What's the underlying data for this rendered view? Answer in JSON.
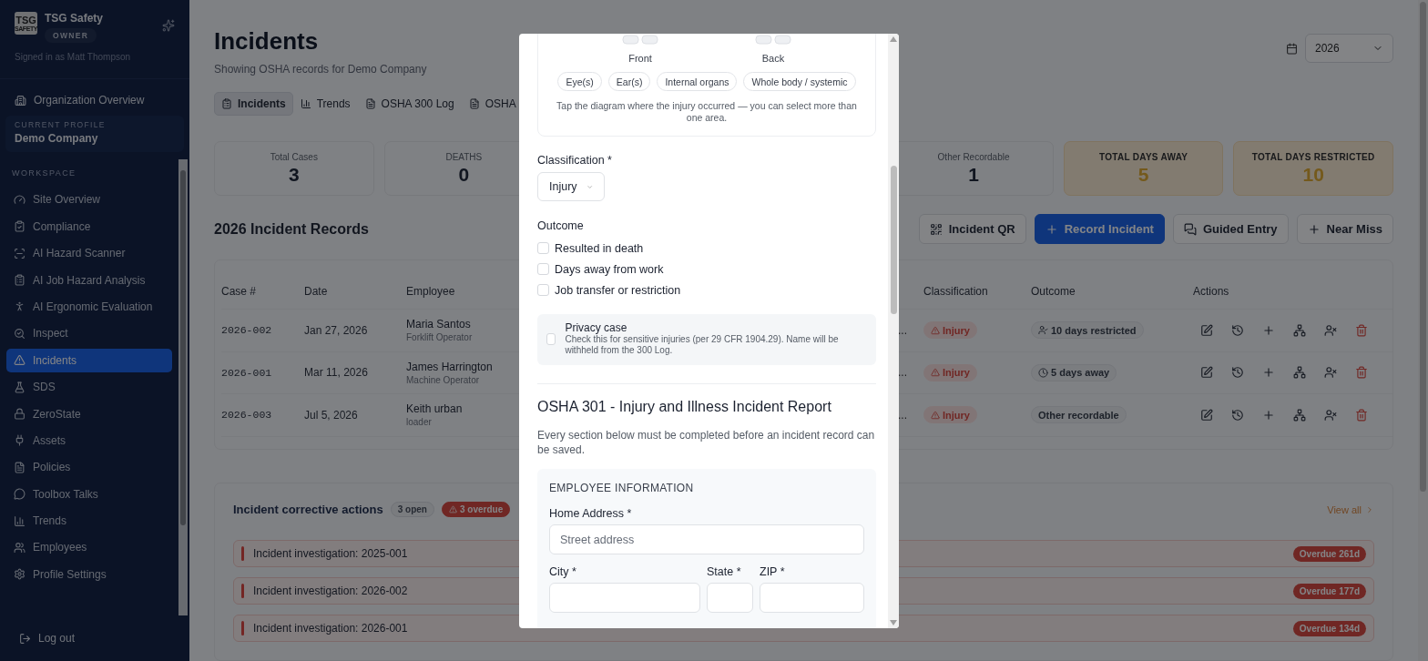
{
  "sidebar": {
    "brand": {
      "logo_top": "TSG",
      "logo_bottom": "SAFETY",
      "name": "TSG Safety",
      "role": "OWNER"
    },
    "signed_in": "Signed in as Matt Thompson",
    "org_link": "Organization Overview",
    "profile": {
      "label": "CURRENT PROFILE",
      "name": "Demo Company"
    },
    "section": "WORKSPACE",
    "items": [
      {
        "label": "Site Overview",
        "selected": false
      },
      {
        "label": "Compliance",
        "selected": false
      },
      {
        "label": "AI Hazard Scanner",
        "selected": false
      },
      {
        "label": "AI Job Hazard Analysis",
        "selected": false
      },
      {
        "label": "AI Ergonomic Evaluation",
        "selected": false
      },
      {
        "label": "Inspect",
        "selected": false
      },
      {
        "label": "Incidents",
        "selected": true
      },
      {
        "label": "SDS",
        "selected": false
      },
      {
        "label": "ZeroState",
        "selected": false
      },
      {
        "label": "Assets",
        "selected": false
      },
      {
        "label": "Policies",
        "selected": false
      },
      {
        "label": "Toolbox Talks",
        "selected": false
      },
      {
        "label": "Trends",
        "selected": false
      },
      {
        "label": "Employees",
        "selected": false
      },
      {
        "label": "Profile Settings",
        "selected": false
      }
    ],
    "logout": "Log out"
  },
  "header": {
    "title": "Incidents",
    "subtitle": "Showing OSHA records for Demo Company",
    "year": "2026"
  },
  "tabs": [
    {
      "label": "Incidents",
      "selected": true
    },
    {
      "label": "Trends",
      "selected": false
    },
    {
      "label": "OSHA 300 Log",
      "selected": false
    },
    {
      "label": "OSHA",
      "selected": false
    }
  ],
  "stats": [
    {
      "label": "Total Cases",
      "value": "3",
      "highlight": false
    },
    {
      "label": "DEATHS",
      "value": "0",
      "highlight": false
    },
    {
      "label": "Other Recordable",
      "value": "1",
      "highlight": false
    },
    {
      "label": "TOTAL DAYS AWAY",
      "value": "5",
      "highlight": true
    },
    {
      "label": "TOTAL DAYS RESTRICTED",
      "value": "10",
      "highlight": true
    }
  ],
  "records": {
    "title": "2026 Incident Records",
    "buttons": [
      {
        "label": "Incident QR",
        "kind": "qr",
        "primary": false
      },
      {
        "label": "Record Incident",
        "kind": "plus",
        "primary": true
      },
      {
        "label": "Guided Entry",
        "kind": "chat",
        "primary": false
      },
      {
        "label": "Near Miss",
        "kind": "plus",
        "primary": false
      }
    ]
  },
  "table": {
    "columns": [
      "Case #",
      "Date",
      "Employee",
      "Classification",
      "Outcome",
      "Actions"
    ],
    "rows": [
      {
        "case": "2026-002",
        "date": "Jan 27, 2026",
        "employee": "Maria Santos",
        "role": "Forklift Operator",
        "column_4": "...",
        "classification": "Injury",
        "outcome": "10 days restricted",
        "kind": "restricted"
      },
      {
        "case": "2026-001",
        "date": "Mar 11, 2026",
        "employee": "James Harrington",
        "role": "Machine Operator",
        "column_4": "...",
        "classification": "Injury",
        "outcome": "5 days away",
        "kind": "away"
      },
      {
        "case": "2026-003",
        "date": "Jul 5, 2026",
        "employee": "Keith urban",
        "role": "loader",
        "column_4": "...",
        "classification": "Injury",
        "outcome": "Other recordable",
        "kind": "other"
      }
    ]
  },
  "corrective_actions": {
    "title": "Incident corrective actions",
    "open": "3 open",
    "overdue": "3 overdue",
    "view_all": "View all",
    "items": [
      {
        "label": "Incident investigation: 2025-001",
        "status": "Overdue 261d"
      },
      {
        "label": "Incident investigation: 2026-002",
        "status": "Overdue 177d"
      },
      {
        "label": "Incident investigation: 2026-001",
        "status": "Overdue 134d"
      }
    ]
  },
  "modal": {
    "diagram": {
      "front": "Front",
      "back": "Back",
      "chips": [
        "Eye(s)",
        "Ear(s)",
        "Internal organs",
        "Whole body / systemic"
      ],
      "hint": "Tap the diagram where the injury occurred — you can select more than one area."
    },
    "classification": {
      "label": "Classification *",
      "value": "Injury"
    },
    "outcome": {
      "label": "Outcome",
      "options": [
        {
          "label": "Resulted in death",
          "checked": false
        },
        {
          "label": "Days away from work",
          "checked": false
        },
        {
          "label": "Job transfer or restriction",
          "checked": false
        }
      ]
    },
    "privacy": {
      "title": "Privacy case",
      "description": "Check this for sensitive injuries (per 29 CFR 1904.29). Name will be withheld from the 300 Log.",
      "checked": false
    },
    "report": {
      "title": "OSHA 301 - Injury and Illness Incident Report",
      "description": "Every section below must be completed before an incident record can be saved.",
      "section": "EMPLOYEE INFORMATION",
      "fields": [
        {
          "label": "Home Address *",
          "placeholder": "Street address"
        },
        {
          "label": "City *"
        },
        {
          "label": "State *"
        },
        {
          "label": "ZIP *"
        }
      ]
    }
  }
}
